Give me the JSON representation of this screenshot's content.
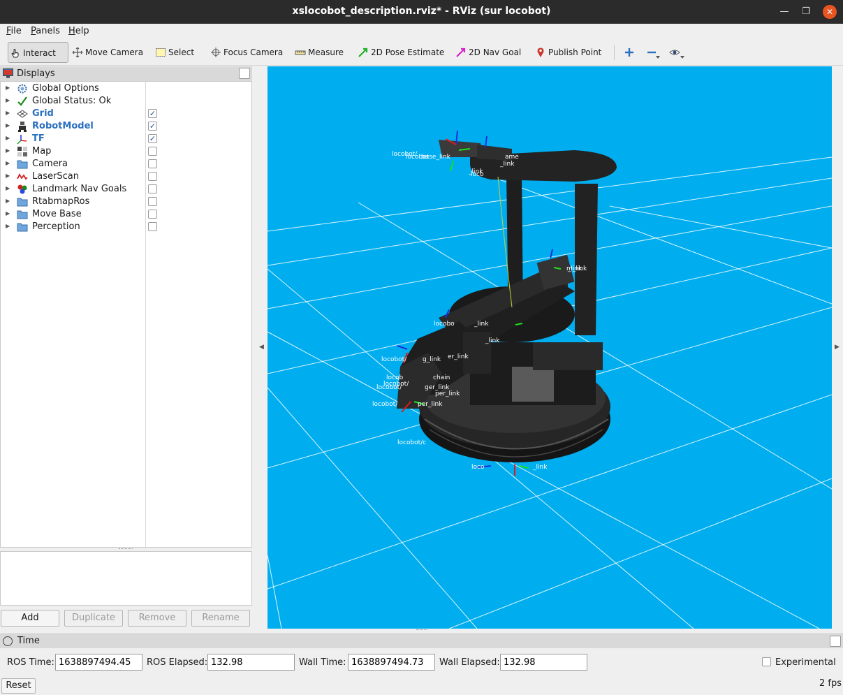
{
  "window": {
    "title": "xslocobot_description.rviz* - RViz (sur locobot)"
  },
  "menu": [
    {
      "prefix": "",
      "u": "F",
      "rest": "ile"
    },
    {
      "prefix": "",
      "u": "P",
      "rest": "anels"
    },
    {
      "prefix": "",
      "u": "H",
      "rest": "elp"
    }
  ],
  "toolbar": {
    "interact": "Interact",
    "move_camera": "Move Camera",
    "select": "Select",
    "focus_camera": "Focus Camera",
    "measure": "Measure",
    "pose_estimate": "2D Pose Estimate",
    "nav_goal": "2D Nav Goal",
    "publish_point": "Publish Point",
    "active_tool": "interact"
  },
  "displays": {
    "title": "Displays",
    "items": [
      {
        "label": "Global Options",
        "icon": "gear-icon",
        "checkbox": false,
        "checked": false,
        "bold": false
      },
      {
        "label": "Global Status: Ok",
        "icon": "check-icon",
        "checkbox": false,
        "checked": false,
        "bold": false
      },
      {
        "label": "Grid",
        "icon": "grid-icon",
        "checkbox": true,
        "checked": true,
        "bold": true
      },
      {
        "label": "RobotModel",
        "icon": "robot-icon",
        "checkbox": true,
        "checked": true,
        "bold": true
      },
      {
        "label": "TF",
        "icon": "axes-icon",
        "checkbox": true,
        "checked": true,
        "bold": true
      },
      {
        "label": "Map",
        "icon": "map-icon",
        "checkbox": true,
        "checked": false,
        "bold": false
      },
      {
        "label": "Camera",
        "icon": "folder-icon",
        "checkbox": true,
        "checked": false,
        "bold": false
      },
      {
        "label": "LaserScan",
        "icon": "laser-icon",
        "checkbox": true,
        "checked": false,
        "bold": false
      },
      {
        "label": "Landmark Nav Goals",
        "icon": "marker-icon",
        "checkbox": true,
        "checked": false,
        "bold": false
      },
      {
        "label": "RtabmapRos",
        "icon": "folder-icon",
        "checkbox": true,
        "checked": false,
        "bold": false
      },
      {
        "label": "Move Base",
        "icon": "folder-icon",
        "checkbox": true,
        "checked": false,
        "bold": false
      },
      {
        "label": "Perception",
        "icon": "folder-icon",
        "checkbox": true,
        "checked": false,
        "bold": false
      }
    ],
    "buttons": {
      "add": "Add",
      "duplicate": "Duplicate",
      "remove": "Remove",
      "rename": "Rename"
    }
  },
  "view": {
    "background": "#00aeef",
    "frame_labels": [
      "locobot/",
      "_link",
      "locobo",
      "_link",
      "_link",
      "_link",
      "locobot/",
      "g_link",
      "er_link",
      "locob",
      "chain",
      "locobot/",
      "locobot/",
      "ger_link",
      "per_link",
      "locobot/",
      "per_link",
      "locobot/c",
      "loco",
      "_link",
      "locobot",
      "base_link",
      "loco",
      "ame",
      "_link",
      "m_link"
    ]
  },
  "time": {
    "title": "Time",
    "ros_time_label": "ROS Time:",
    "ros_time": "1638897494.45",
    "ros_elapsed_label": "ROS Elapsed:",
    "ros_elapsed": "132.98",
    "wall_time_label": "Wall Time:",
    "wall_time": "1638897494.73",
    "wall_elapsed_label": "Wall Elapsed:",
    "wall_elapsed": "132.98",
    "experimental_label": "Experimental",
    "reset": "Reset",
    "fps": "2 fps"
  }
}
